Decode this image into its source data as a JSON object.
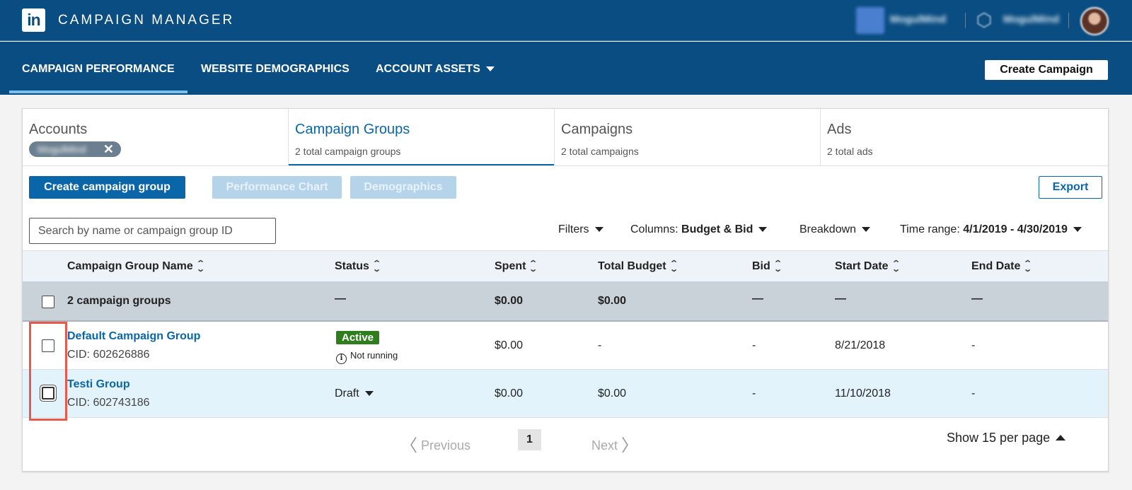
{
  "app": {
    "logo_text": "in",
    "title": "CAMPAIGN MANAGER",
    "account_name": "MogulMind",
    "org_name": "MogulMind"
  },
  "nav": {
    "tabs": [
      "CAMPAIGN PERFORMANCE",
      "WEBSITE DEMOGRAPHICS",
      "ACCOUNT ASSETS"
    ],
    "create_campaign": "Create Campaign"
  },
  "entity_tabs": [
    {
      "title": "Accounts",
      "chip": "MogulMind"
    },
    {
      "title": "Campaign Groups",
      "subtitle": "2 total campaign groups"
    },
    {
      "title": "Campaigns",
      "subtitle": "2 total campaigns"
    },
    {
      "title": "Ads",
      "subtitle": "2 total ads"
    }
  ],
  "toolbar": {
    "create_group": "Create campaign group",
    "performance_chart": "Performance Chart",
    "demographics": "Demographics",
    "export": "Export",
    "search_placeholder": "Search by name or campaign group ID"
  },
  "filters": {
    "filters_label": "Filters",
    "columns_label": "Columns:",
    "columns_value": "Budget & Bid",
    "breakdown_label": "Breakdown",
    "time_label": "Time range:",
    "time_value": "4/1/2019 - 4/30/2019"
  },
  "table": {
    "columns": [
      "Campaign Group Name",
      "Status",
      "Spent",
      "Total Budget",
      "Bid",
      "Start Date",
      "End Date"
    ],
    "summary": {
      "name": "2 campaign groups",
      "status": "—",
      "spent": "$0.00",
      "budget": "$0.00",
      "bid": "—",
      "start": "—",
      "end": "—"
    },
    "rows": [
      {
        "name": "Default Campaign Group",
        "cid": "CID: 602626886",
        "status": "Active",
        "status_note": "Not running",
        "spent": "$0.00",
        "budget": "-",
        "bid": "-",
        "start": "8/21/2018",
        "end": "-"
      },
      {
        "name": "Testi Group",
        "cid": "CID: 602743186",
        "status": "Draft",
        "spent": "$0.00",
        "budget": "$0.00",
        "bid": "-",
        "start": "11/10/2018",
        "end": "-"
      }
    ]
  },
  "pagination": {
    "previous": "Previous",
    "page": "1",
    "next": "Next",
    "per_page": "Show 15 per page"
  },
  "colors": {
    "header_bg": "#0a4d82",
    "accent": "#0a66a8",
    "active_badge": "#2f7d1c",
    "annotation": "#e8584b"
  }
}
